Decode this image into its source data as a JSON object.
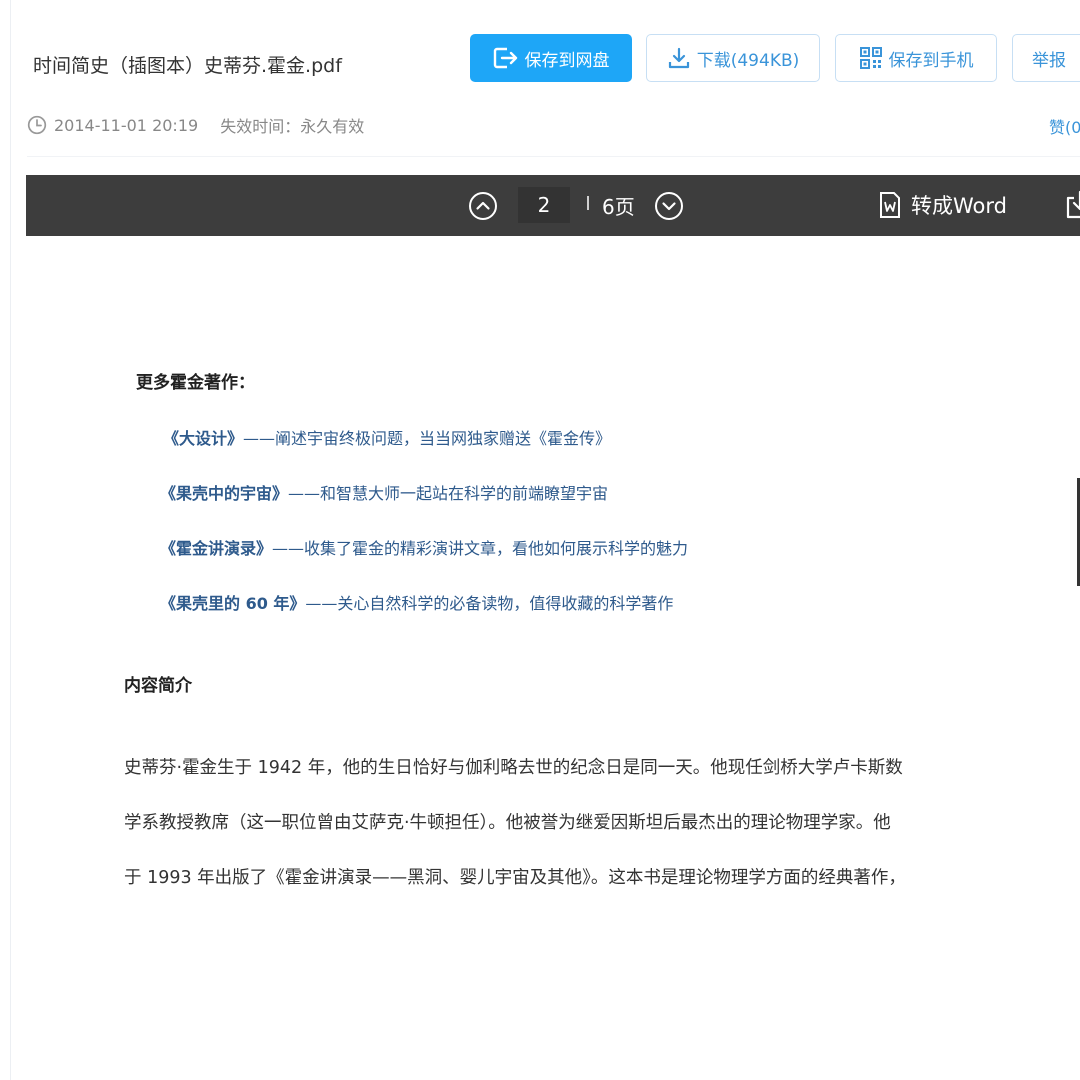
{
  "header": {
    "file_title": "时间简史（插图本）史蒂芬.霍金.pdf",
    "buttons": {
      "save_to_cloud": "保存到网盘",
      "download": "下载(494KB)",
      "save_to_phone": "保存到手机",
      "report": "举报"
    },
    "meta": {
      "date": "2014-11-01 20:19",
      "expire": "失效时间：永久有效",
      "like": "赞(0"
    }
  },
  "toolbar": {
    "current_page": "2",
    "total_pages": "6页",
    "convert_word": "转成Word"
  },
  "document": {
    "more_works_heading": "更多霍金著作：",
    "works": [
      {
        "title": "《大设计》",
        "desc": "——阐述宇宙终极问题，当当网独家赠送《霍金传》"
      },
      {
        "title": "《果壳中的宇宙》",
        "desc": "——和智慧大师一起站在科学的前端瞭望宇宙"
      },
      {
        "title": "《霍金讲演录》",
        "desc": "——收集了霍金的精彩演讲文章，看他如何展示科学的魅力"
      },
      {
        "title": "《果壳里的 60 年》",
        "desc": "——关心自然科学的必备读物，值得收藏的科学著作"
      }
    ],
    "intro_heading": "内容简介",
    "intro_lines": [
      "史蒂芬·霍金生于 1942 年，他的生日恰好与伽利略去世的纪念日是同一天。他现任剑桥大学卢卡斯数",
      "学系教授教席（这一职位曾由艾萨克·牛顿担任）。他被誉为继爱因斯坦后最杰出的理论物理学家。他",
      "于 1993 年出版了《霍金讲演录——黑洞、婴儿宇宙及其他》。这本书是理论物理学方面的经典著作，"
    ]
  }
}
